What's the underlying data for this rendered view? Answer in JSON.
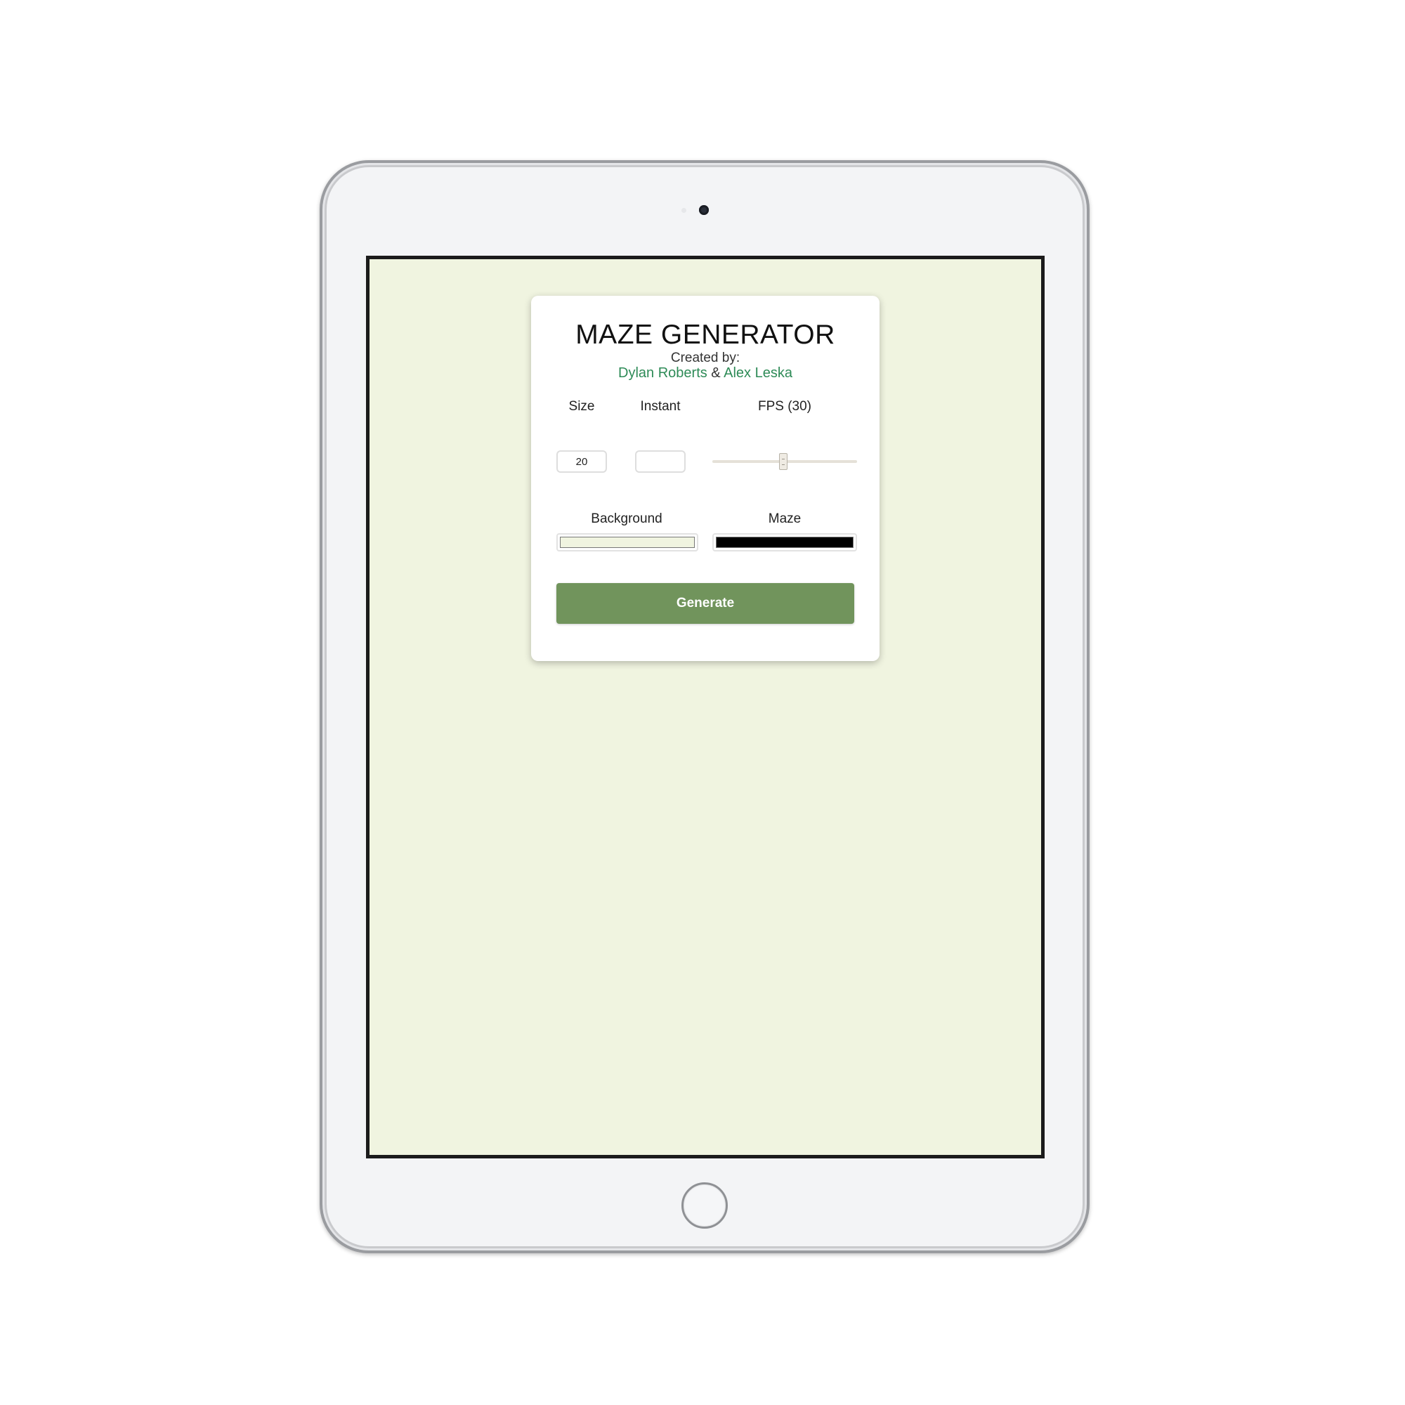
{
  "app": {
    "title": "MAZE GENERATOR",
    "created_by": "Created by:",
    "authors": {
      "author1": "Dylan Roberts",
      "separator": " & ",
      "author2": "Alex Leska"
    }
  },
  "controls": {
    "size_label": "Size",
    "size_value": "20",
    "instant_label": "Instant",
    "instant_value": "",
    "fps_label": "FPS (30)",
    "fps_value": 30,
    "fps_min": 1,
    "fps_max": 60,
    "background_label": "Background",
    "background_color": "#f0f4e0",
    "maze_label": "Maze",
    "maze_color": "#000000",
    "generate_label": "Generate"
  },
  "theme": {
    "screen_background": "#f0f4e0",
    "accent": "#71945c",
    "link_color": "#2e8b57"
  },
  "device": {
    "icons": [
      "camera-icon",
      "home-button-icon"
    ]
  }
}
